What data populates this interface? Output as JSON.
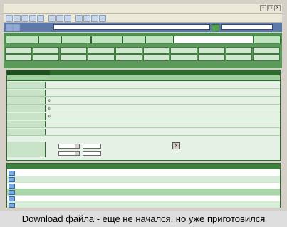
{
  "menubar": {
    "items": [
      "",
      "",
      "",
      "",
      "",
      "",
      "",
      ""
    ]
  },
  "addressbar": {
    "label": "",
    "url": "",
    "search_text": ""
  },
  "tabs_top": [
    "",
    "",
    "",
    "",
    "",
    "",
    "",
    ""
  ],
  "tabs_sub": {
    "line1": [
      "",
      "",
      "",
      "",
      "",
      "",
      "",
      "",
      "",
      ""
    ],
    "line2": [
      "",
      "",
      "",
      "",
      "",
      "",
      "",
      "",
      "",
      ""
    ]
  },
  "details": {
    "rows": [
      {
        "key": "",
        "value": "",
        "link": false
      },
      {
        "key": "",
        "value": "",
        "link": false
      },
      {
        "key": "",
        "value": "0",
        "link": false
      },
      {
        "key": "",
        "value": "0",
        "link": false
      },
      {
        "key": "",
        "value": "0",
        "link": false
      },
      {
        "key": "",
        "value": "",
        "link": true
      },
      {
        "key": "",
        "value": "",
        "link": true
      }
    ],
    "controls_label": "",
    "select1": "",
    "input1": "",
    "select2": "",
    "input2": ""
  },
  "downloads": {
    "headers": [
      "",
      "",
      "",
      "",
      "",
      "",
      "",
      "",
      "",
      "",
      ""
    ],
    "rows": [
      [
        "",
        "",
        "",
        "",
        "",
        "",
        "",
        "",
        "",
        "",
        ""
      ],
      [
        "",
        "",
        "",
        "",
        "",
        "",
        "",
        "",
        "",
        "",
        ""
      ],
      [
        "",
        "",
        "",
        "",
        "",
        "",
        "",
        "",
        "",
        "",
        ""
      ],
      [
        "",
        "",
        "",
        "",
        "",
        "",
        "",
        "",
        "",
        "",
        ""
      ],
      [
        "",
        "",
        "",
        "",
        "",
        "",
        "",
        "",
        "",
        "",
        ""
      ],
      [
        "",
        "",
        "",
        "",
        "",
        "",
        "",
        "",
        "",
        "",
        ""
      ]
    ]
  },
  "caption": "Download файла - еще не начался, но уже приготовился",
  "colors": {
    "green_dark": "#2f6a2f",
    "green_tab": "#4e8e4e",
    "green_light": "#e4f1e4",
    "address_bar": "#5e78a8",
    "link": "#1d3fb0"
  }
}
